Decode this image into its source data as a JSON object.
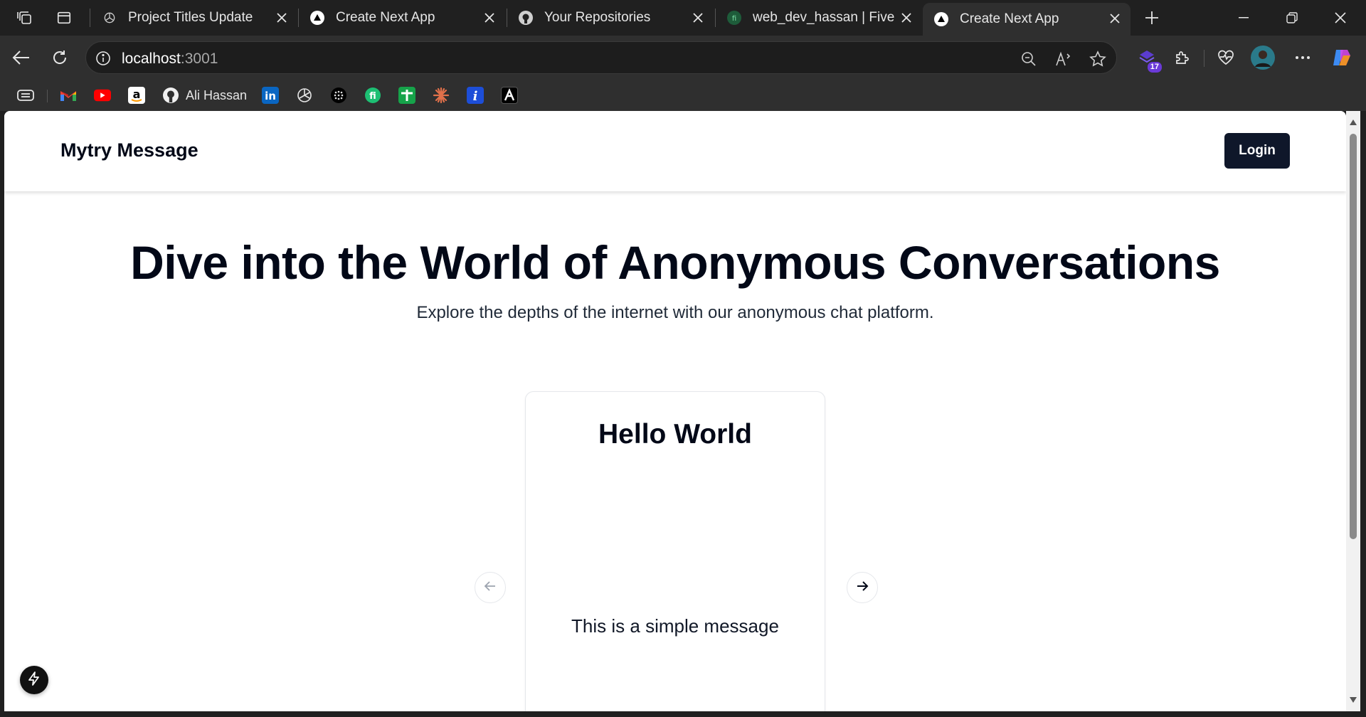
{
  "tabs": [
    {
      "title": "Project Titles Update",
      "favicon": "openai-icon",
      "active": false
    },
    {
      "title": "Create Next App",
      "favicon": "nextjs-triangle-icon",
      "active": false
    },
    {
      "title": "Your Repositories",
      "favicon": "github-icon",
      "active": false
    },
    {
      "title": "web_dev_hassan | Fiverr",
      "favicon": "fiverr-icon",
      "active": false
    },
    {
      "title": "Create Next App",
      "favicon": "nextjs-triangle-icon",
      "active": true
    }
  ],
  "address": {
    "host": "localhost",
    "port": ":3001"
  },
  "extensions": {
    "badge_count": "17"
  },
  "bookmarks": [
    {
      "label": "",
      "icon": "reading-list-icon"
    },
    {
      "label": "",
      "icon": "gmail-icon"
    },
    {
      "label": "",
      "icon": "youtube-icon"
    },
    {
      "label": "",
      "icon": "amazon-icon"
    },
    {
      "label": "Ali Hassan",
      "icon": "github-icon"
    },
    {
      "label": "",
      "icon": "linkedin-icon"
    },
    {
      "label": "",
      "icon": "openai-icon"
    },
    {
      "label": "",
      "icon": "perplexity-icon"
    },
    {
      "label": "",
      "icon": "fiverr-icon"
    },
    {
      "label": "",
      "icon": "sheets-plus-icon"
    },
    {
      "label": "",
      "icon": "claude-icon"
    },
    {
      "label": "",
      "icon": "info-icon"
    },
    {
      "label": "",
      "icon": "notion-ai-icon"
    }
  ],
  "site": {
    "brand": "Mytry Message",
    "login_label": "Login",
    "hero_title": "Dive into the World of Anonymous Conversations",
    "hero_subtitle": "Explore the depths of the internet with our anonymous chat platform.",
    "card": {
      "title": "Hello World",
      "body": "This is a simple message"
    }
  },
  "colors": {
    "browser_frame": "#202020",
    "toolbar": "#2f2f2f",
    "login_button": "#0f172a",
    "text_dark": "#020817"
  }
}
